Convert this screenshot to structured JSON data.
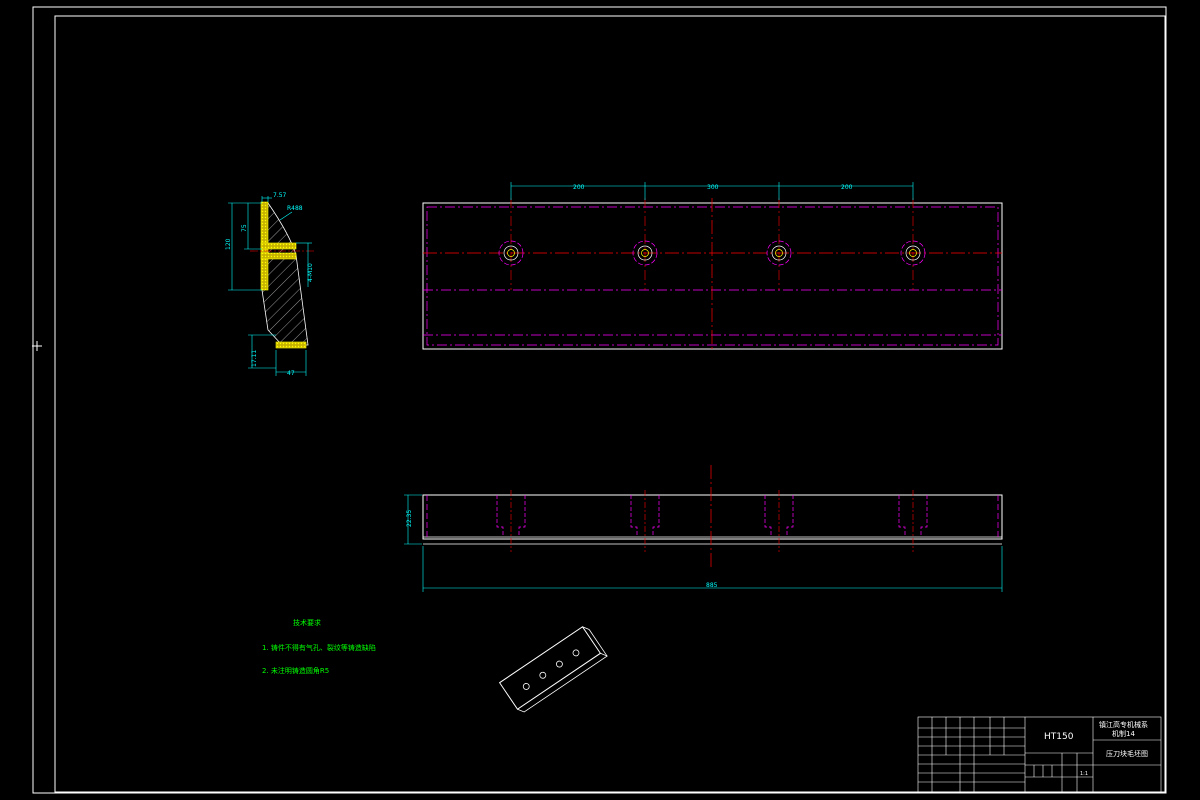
{
  "colors": {
    "background": "#000000",
    "frame": "#ffffff",
    "dimension": "#00ffff",
    "centerline": "#ff0000",
    "hidden": "#ff00ff",
    "hatch": "#ffff00",
    "note": "#00ff00",
    "outline": "#ffffff"
  },
  "section_view": {
    "dims": {
      "top_width": "7.57",
      "radius": "R488",
      "height_total": "120",
      "height_upper": "75",
      "hole": "4-M10",
      "bottom_height": "17.11",
      "bottom_width": "47"
    }
  },
  "top_view": {
    "dims": {
      "spacing_1": "200",
      "spacing_2": "300",
      "spacing_3": "200"
    }
  },
  "front_view": {
    "dims": {
      "height": "22.35",
      "length": "885"
    }
  },
  "notes": {
    "heading": "技术要求",
    "line1": "1. 铸件不得有气孔、裂纹等铸造缺陷",
    "line2": "2. 未注明铸造圆角R5"
  },
  "title_block": {
    "material": "HT150",
    "school": "镇江高专机械系",
    "class": "机制14",
    "drawing_name": "压刀块毛坯图",
    "scale": "1:1"
  }
}
